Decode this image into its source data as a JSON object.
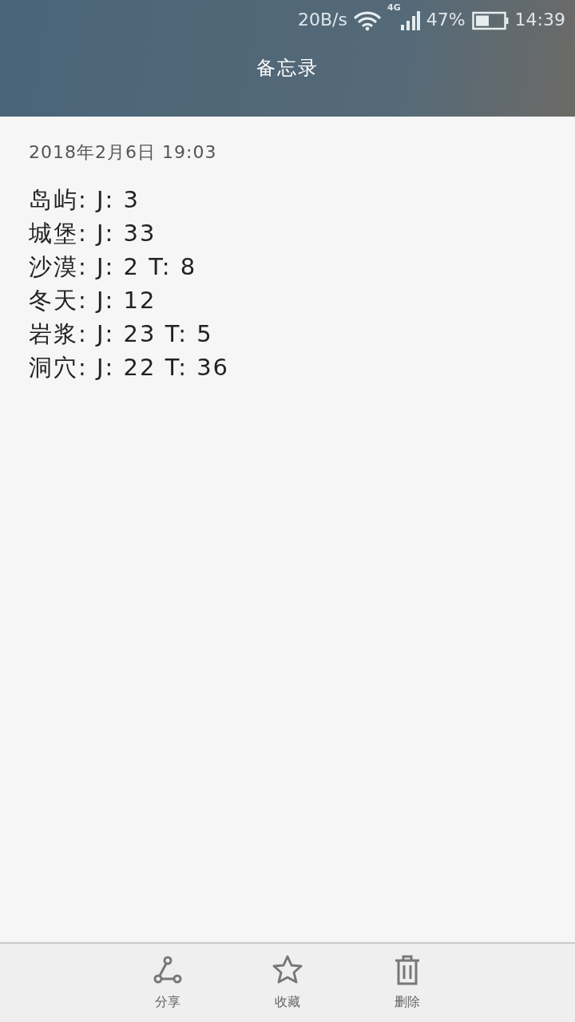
{
  "status_bar": {
    "speed": "20B/s",
    "network": "4G",
    "battery": "47%",
    "time": "14:39"
  },
  "title": "备忘录",
  "note": {
    "date": "2018年2月6日 19:03",
    "lines": [
      "岛屿: J: 3",
      "城堡: J: 33",
      "沙漠: J: 2 T: 8",
      "冬天: J: 12",
      "岩浆: J: 23 T: 5",
      "洞穴: J: 22 T: 36"
    ]
  },
  "toolbar": [
    {
      "kind": "share",
      "label": "分享"
    },
    {
      "kind": "favorite",
      "label": "收藏"
    },
    {
      "kind": "delete",
      "label": "删除"
    }
  ]
}
